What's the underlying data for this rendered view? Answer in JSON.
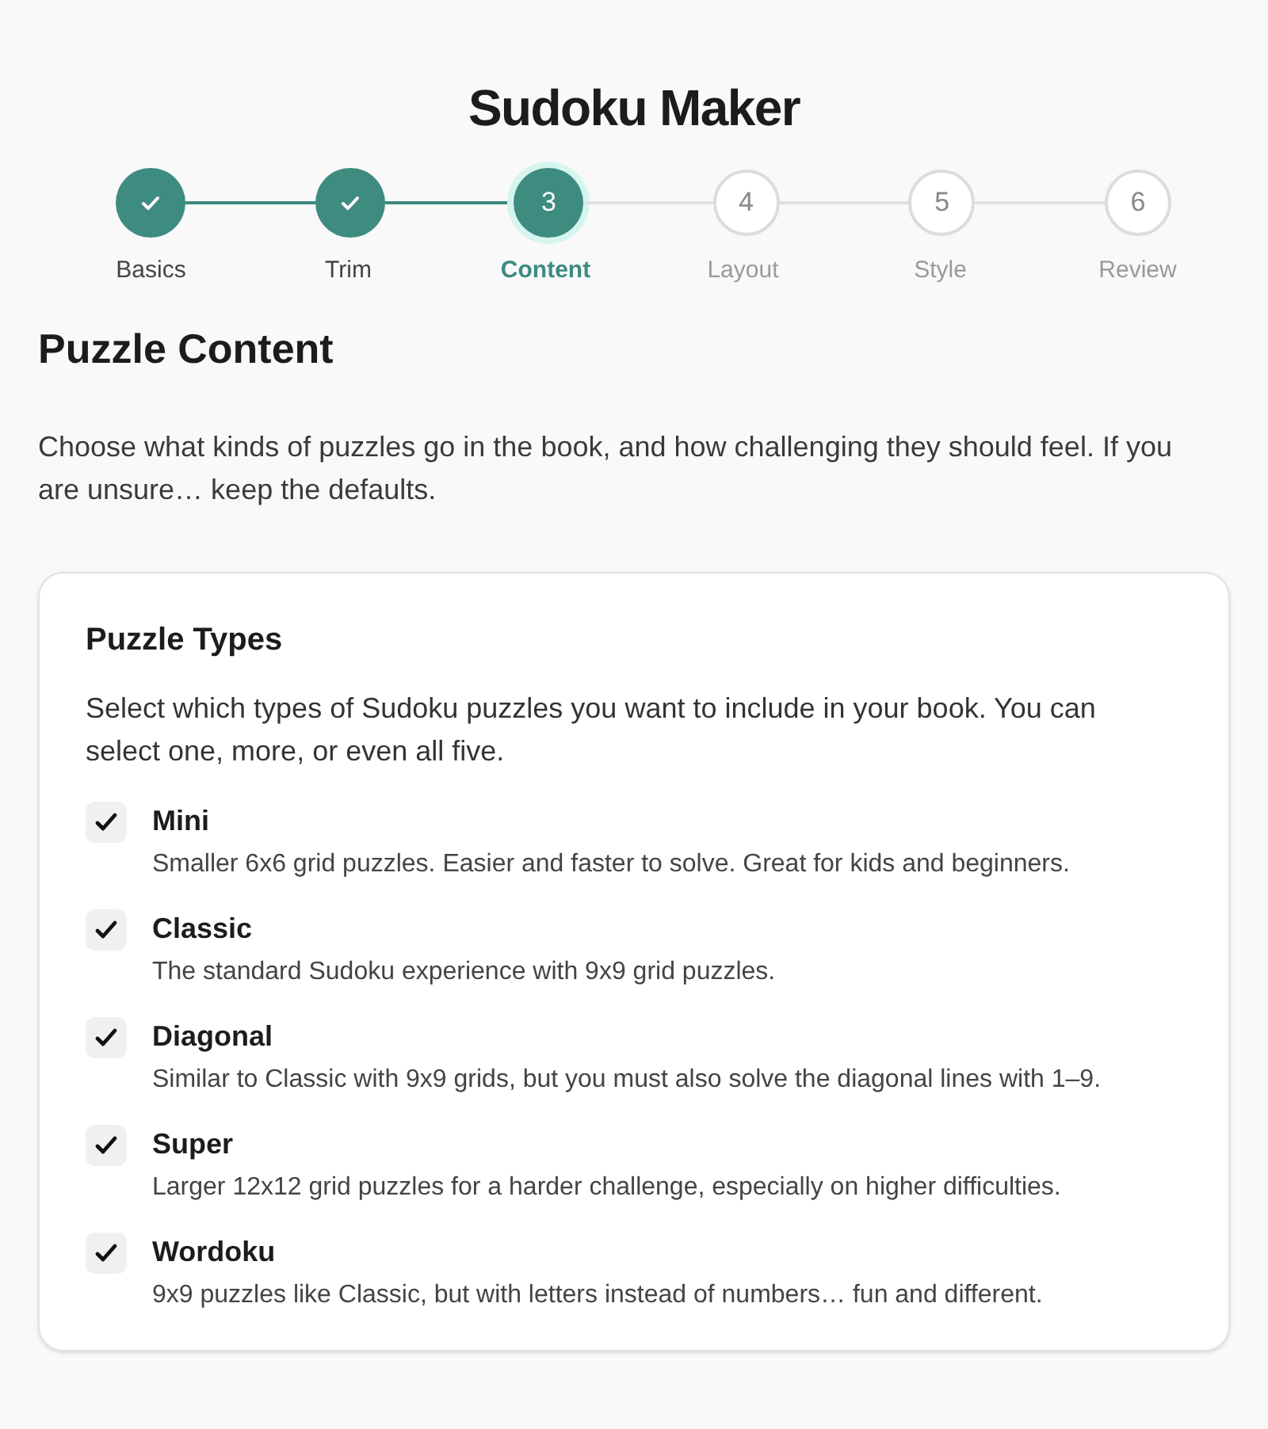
{
  "title": "Sudoku Maker",
  "steps": [
    {
      "label": "Basics",
      "kind": "done"
    },
    {
      "label": "Trim",
      "kind": "done"
    },
    {
      "label": "Content",
      "number": "3",
      "kind": "current"
    },
    {
      "label": "Layout",
      "number": "4",
      "kind": "upcoming"
    },
    {
      "label": "Style",
      "number": "5",
      "kind": "upcoming"
    },
    {
      "label": "Review",
      "number": "6",
      "kind": "upcoming"
    }
  ],
  "section": {
    "heading": "Puzzle Content",
    "intro": "Choose what kinds of puzzles go in the book, and how challenging they should feel. If you are unsure… keep the defaults."
  },
  "card": {
    "title": "Puzzle Types",
    "description": "Select which types of Sudoku puzzles you want to include in your book. You can select one, more, or even all five.",
    "options": [
      {
        "name": "Mini",
        "description": "Smaller 6x6 grid puzzles. Easier and faster to solve. Great for kids and beginners.",
        "checked": true
      },
      {
        "name": "Classic",
        "description": "The standard Sudoku experience with 9x9 grid puzzles.",
        "checked": true
      },
      {
        "name": "Diagonal",
        "description": "Similar to Classic with 9x9 grids, but you must also solve the diagonal lines with 1–9.",
        "checked": true
      },
      {
        "name": "Super",
        "description": "Larger 12x12 grid puzzles for a harder challenge, especially on higher difficulties.",
        "checked": true
      },
      {
        "name": "Wordoku",
        "description": "9x9 puzzles like Classic, but with letters instead of numbers… fun and different.",
        "checked": true
      }
    ]
  }
}
